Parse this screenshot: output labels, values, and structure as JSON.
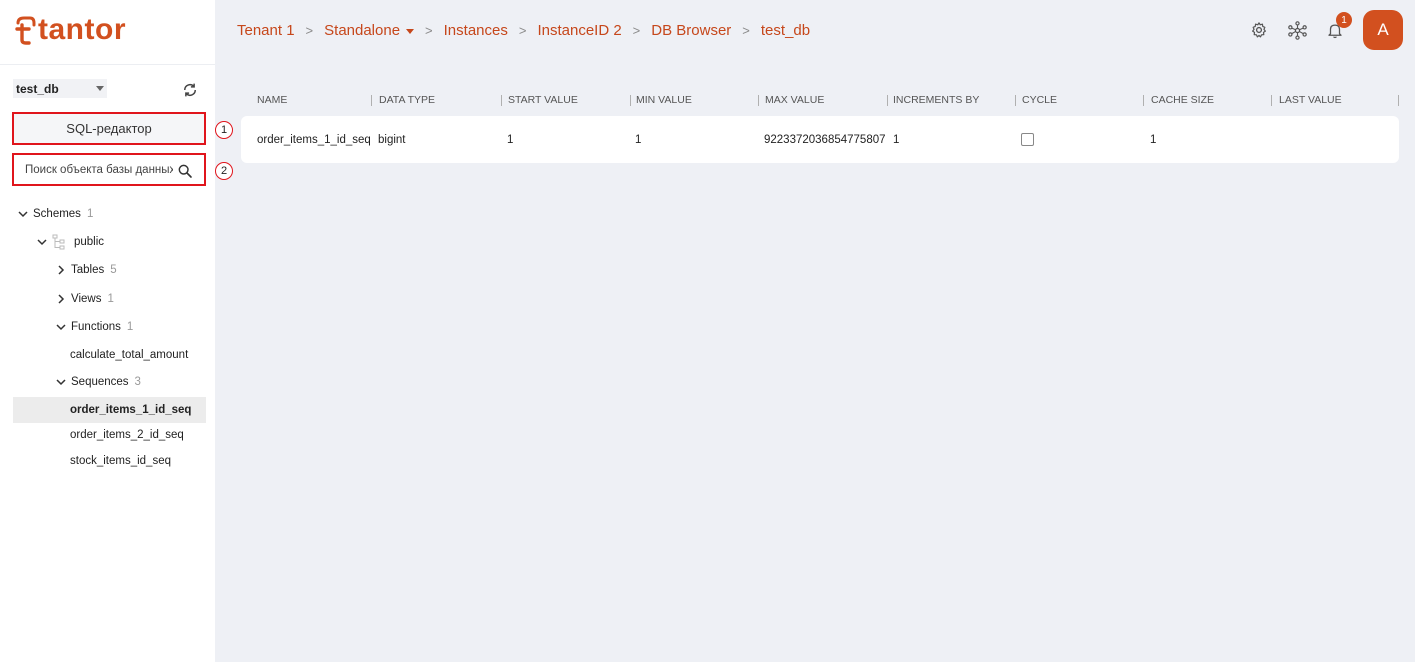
{
  "brand": {
    "name": "tantor",
    "accent": "#d2501f"
  },
  "breadcrumb": {
    "items": [
      "Tenant 1",
      "Standalone",
      "Instances",
      "InstanceID 2",
      "DB Browser",
      "test_db"
    ]
  },
  "header": {
    "icons": [
      "gear-icon",
      "network-icon",
      "bell-icon"
    ],
    "notification_count": "1",
    "avatar_letter": "A"
  },
  "sidebar": {
    "database": "test_db",
    "sql_editor_label": "SQL-редактор",
    "search_placeholder": "Поиск объекта базы данных",
    "callouts": [
      "1",
      "2"
    ],
    "tree": {
      "schemes": {
        "label": "Schemes",
        "count": "1"
      },
      "public": {
        "label": "public"
      },
      "tables": {
        "label": "Tables",
        "count": "5"
      },
      "views": {
        "label": "Views",
        "count": "1"
      },
      "functions": {
        "label": "Functions",
        "count": "1"
      },
      "function_items": [
        "calculate_total_amount"
      ],
      "sequences": {
        "label": "Sequences",
        "count": "3"
      },
      "sequence_items": [
        "order_items_1_id_seq",
        "order_items_2_id_seq",
        "stock_items_id_seq"
      ],
      "selected": "order_items_1_id_seq"
    }
  },
  "table": {
    "columns": [
      "NAME",
      "DATA TYPE",
      "START VALUE",
      "MIN VALUE",
      "MAX VALUE",
      "INCREMENTS BY",
      "CYCLE",
      "CACHE SIZE",
      "LAST VALUE"
    ],
    "rows": [
      {
        "name": "order_items_1_id_seq",
        "data_type": "bigint",
        "start_value": "1",
        "min_value": "1",
        "max_value": "9223372036854775807",
        "increments_by": "1",
        "cycle": false,
        "cache_size": "1",
        "last_value": ""
      }
    ]
  }
}
